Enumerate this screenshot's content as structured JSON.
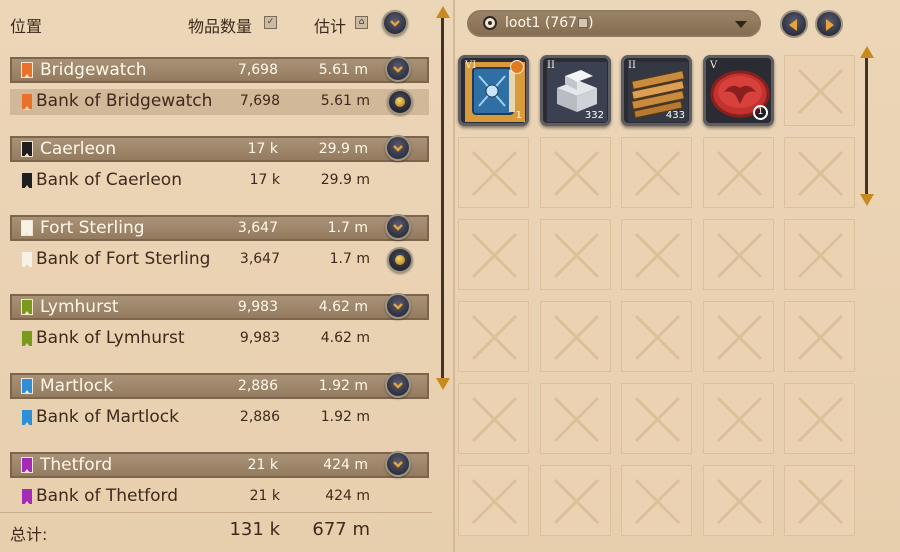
{
  "header": {
    "location_label": "位置",
    "quantity_label": "物品数量",
    "estimate_label": "估计"
  },
  "cities": [
    {
      "name": "Bridgewatch",
      "qty": "7,698",
      "est": "5.61 m",
      "color": "#e8722a",
      "bank": {
        "name": "Bank of Bridgewatch",
        "qty": "7,698",
        "est": "5.61 m",
        "highlighted": true,
        "has_coin_button": true
      }
    },
    {
      "name": "Caerleon",
      "qty": "17 k",
      "est": "29.9 m",
      "color": "#1e1e1e",
      "bank": {
        "name": "Bank of Caerleon",
        "qty": "17 k",
        "est": "29.9 m",
        "highlighted": false,
        "has_coin_button": false
      }
    },
    {
      "name": "Fort Sterling",
      "qty": "3,647",
      "est": "1.7 m",
      "color": "#f7f2e6",
      "bank": {
        "name": "Bank of Fort Sterling",
        "qty": "3,647",
        "est": "1.7 m",
        "highlighted": false,
        "has_coin_button": true
      }
    },
    {
      "name": "Lymhurst",
      "qty": "9,983",
      "est": "4.62 m",
      "color": "#7a9a1c",
      "bank": {
        "name": "Bank of Lymhurst",
        "qty": "9,983",
        "est": "4.62 m",
        "highlighted": false,
        "has_coin_button": false
      }
    },
    {
      "name": "Martlock",
      "qty": "2,886",
      "est": "1.92 m",
      "color": "#2f8fd6",
      "bank": {
        "name": "Bank of Martlock",
        "qty": "2,886",
        "est": "1.92 m",
        "highlighted": false,
        "has_coin_button": false
      }
    },
    {
      "name": "Thetford",
      "qty": "21 k",
      "est": "424 m",
      "color": "#a42ab8",
      "bank": {
        "name": "Bank of Thetford",
        "qty": "21 k",
        "est": "424 m",
        "highlighted": false,
        "has_coin_button": false
      }
    }
  ],
  "footer": {
    "total_label": "总计:",
    "total_qty": "131 k",
    "total_est": "677 m"
  },
  "container": {
    "selected": "loot1 (767"
  },
  "items": [
    {
      "tier": "VI",
      "kind": "tome-icon",
      "count": "1",
      "count_style": "plain",
      "has_badge": true
    },
    {
      "tier": "II",
      "kind": "stone-blocks-icon",
      "count": "332",
      "count_style": "plain",
      "has_badge": false
    },
    {
      "tier": "II",
      "kind": "planks-icon",
      "count": "433",
      "count_style": "plain",
      "has_badge": false
    },
    {
      "tier": "V",
      "kind": "faction-token-icon",
      "count": "1",
      "count_style": "circle",
      "has_badge": false
    }
  ],
  "colors": {
    "panel_bg": "#e9d3b4",
    "city_row_bg": "#9c8366",
    "accent_gold": "#c78a1f",
    "button_dark": "#2f3040"
  }
}
